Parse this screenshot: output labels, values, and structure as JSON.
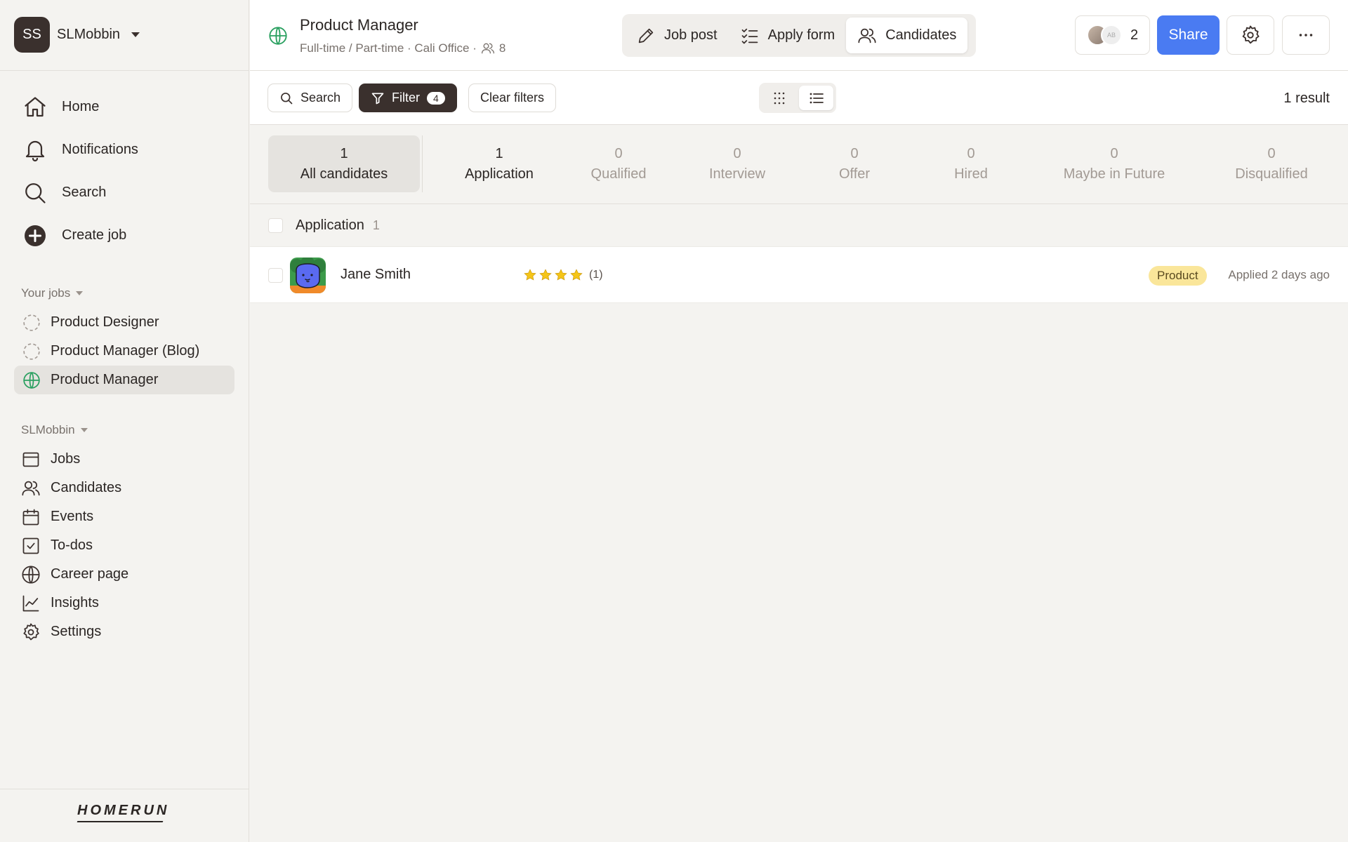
{
  "workspace": {
    "initials": "SS",
    "name": "SLMobbin"
  },
  "nav": [
    {
      "label": "Home",
      "icon": "home-icon"
    },
    {
      "label": "Notifications",
      "icon": "bell-icon"
    },
    {
      "label": "Search",
      "icon": "search-icon"
    },
    {
      "label": "Create job",
      "icon": "plus-circle-icon"
    }
  ],
  "your_jobs": {
    "label": "Your jobs",
    "items": [
      {
        "label": "Product Designer",
        "status": "draft"
      },
      {
        "label": "Product Manager (Blog)",
        "status": "draft"
      },
      {
        "label": "Product Manager",
        "status": "published"
      }
    ]
  },
  "org": {
    "label": "SLMobbin",
    "items": [
      {
        "label": "Jobs",
        "icon": "browser-icon"
      },
      {
        "label": "Candidates",
        "icon": "users-icon"
      },
      {
        "label": "Events",
        "icon": "calendar-icon"
      },
      {
        "label": "To-dos",
        "icon": "checkbox-icon"
      },
      {
        "label": "Career page",
        "icon": "globe-icon"
      },
      {
        "label": "Insights",
        "icon": "chart-line-icon"
      },
      {
        "label": "Settings",
        "icon": "gear-icon"
      }
    ]
  },
  "brand": "HOMERUN",
  "header": {
    "title": "Product Manager",
    "subtitle": "Full-time / Part-time · Cali Office ·",
    "members": "8",
    "tabs": [
      {
        "label": "Job post",
        "icon": "pencil-icon"
      },
      {
        "label": "Apply form",
        "icon": "checklist-icon"
      },
      {
        "label": "Candidates",
        "icon": "users-icon"
      }
    ],
    "active_tab": "Candidates",
    "collaborators_count": "2",
    "collaborator_initials": "AB",
    "share_label": "Share"
  },
  "toolbar": {
    "search_label": "Search",
    "filter_label": "Filter",
    "filter_count": "4",
    "clear_label": "Clear filters",
    "result_text": "1 result"
  },
  "stages": [
    {
      "count": "1",
      "label": "All candidates"
    },
    {
      "count": "1",
      "label": "Application"
    },
    {
      "count": "0",
      "label": "Qualified"
    },
    {
      "count": "0",
      "label": "Interview"
    },
    {
      "count": "0",
      "label": "Offer"
    },
    {
      "count": "0",
      "label": "Hired"
    },
    {
      "count": "0",
      "label": "Maybe in Future"
    },
    {
      "count": "0",
      "label": "Disqualified"
    }
  ],
  "group": {
    "title": "Application",
    "count": "1"
  },
  "candidate": {
    "name": "Jane Smith",
    "rating_count": "(1)",
    "stars": 4,
    "tag": "Product",
    "applied": "Applied 2 days ago"
  },
  "colors": {
    "accent": "#4a7bf2",
    "dark": "#3a302d",
    "published": "#2aa060",
    "star": "#f5c518",
    "tag_bg": "#fae69a"
  }
}
